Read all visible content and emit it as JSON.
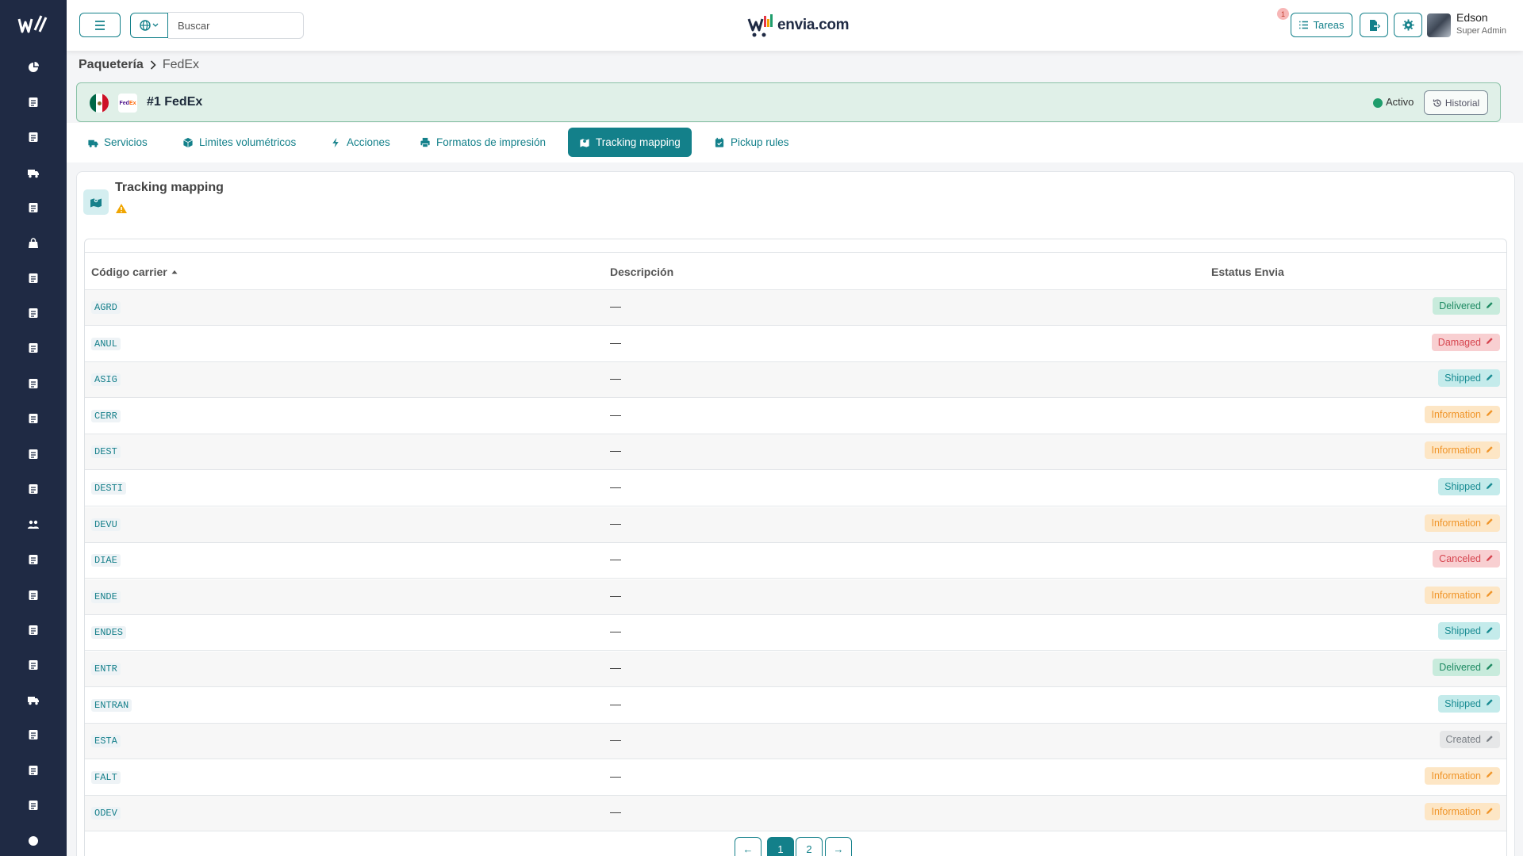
{
  "app": {
    "brand": "envia.com",
    "search_placeholder": "Buscar",
    "tasks_label": "Tareas",
    "tasks_count": "1",
    "user_name": "Edson",
    "user_role": "Super Admin"
  },
  "sidebar_icons": [
    "dashboard-icon",
    "id-badge-icon",
    "x-box-icon",
    "truck-icon",
    "calendar-icon",
    "bag-icon",
    "money-icon",
    "document-icon",
    "invoice-icon",
    "card-icon",
    "cash-icon",
    "id-card-icon",
    "store-icon",
    "users-icon",
    "contact-card-icon",
    "edit-doc-icon",
    "list-card-icon",
    "file-icon",
    "shipping-truck-icon",
    "doc-lines-icon",
    "ticket-icon",
    "file-text-icon",
    "circle-icon"
  ],
  "breadcrumb": {
    "root": "Paquetería",
    "current": "FedEx"
  },
  "carrier": {
    "title": "#1 FedEx",
    "logo_text": "FedEx",
    "status": "Activo",
    "history_label": "Historial"
  },
  "tabs": [
    {
      "label": "Servicios",
      "icon": "truck-icon"
    },
    {
      "label": "Limites volumétricos",
      "icon": "box-icon"
    },
    {
      "label": "Acciones",
      "icon": "bolt-icon"
    },
    {
      "label": "Formatos de impresión",
      "icon": "printer-icon"
    },
    {
      "label": "Tracking mapping",
      "icon": "map-icon",
      "active": true
    },
    {
      "label": "Pickup rules",
      "icon": "calendar-check-icon"
    }
  ],
  "panel": {
    "title": "Tracking mapping"
  },
  "table": {
    "columns": [
      "Código carrier",
      "Descripción",
      "Estatus Envia"
    ],
    "rows": [
      {
        "code": "AGRD",
        "description": "—",
        "status": "Delivered"
      },
      {
        "code": "ANUL",
        "description": "—",
        "status": "Damaged"
      },
      {
        "code": "ASIG",
        "description": "—",
        "status": "Shipped"
      },
      {
        "code": "CERR",
        "description": "—",
        "status": "Information"
      },
      {
        "code": "DEST",
        "description": "—",
        "status": "Information"
      },
      {
        "code": "DESTI",
        "description": "—",
        "status": "Shipped"
      },
      {
        "code": "DEVU",
        "description": "—",
        "status": "Information"
      },
      {
        "code": "DIAE",
        "description": "—",
        "status": "Canceled"
      },
      {
        "code": "ENDE",
        "description": "—",
        "status": "Information"
      },
      {
        "code": "ENDES",
        "description": "—",
        "status": "Shipped"
      },
      {
        "code": "ENTR",
        "description": "—",
        "status": "Delivered"
      },
      {
        "code": "ENTRAN",
        "description": "—",
        "status": "Shipped"
      },
      {
        "code": "ESTA",
        "description": "—",
        "status": "Created"
      },
      {
        "code": "FALT",
        "description": "—",
        "status": "Information"
      },
      {
        "code": "ODEV",
        "description": "—",
        "status": "Information"
      }
    ]
  },
  "status_colors": {
    "Delivered": {
      "bg": "#c8ebdc",
      "fg": "#1e8a62"
    },
    "Damaged": {
      "bg": "#f8cfd1",
      "fg": "#d6454f"
    },
    "Shipped": {
      "bg": "#c4ebeb",
      "fg": "#188b92"
    },
    "Information": {
      "bg": "#fde6c5",
      "fg": "#f0952a"
    },
    "Canceled": {
      "bg": "#f8cfd1",
      "fg": "#d6454f"
    },
    "Created": {
      "bg": "#e6e7e8",
      "fg": "#7a7f85"
    }
  },
  "pagination": {
    "prev": "←",
    "pages": [
      "1",
      "2"
    ],
    "current": "1",
    "next": "→"
  }
}
